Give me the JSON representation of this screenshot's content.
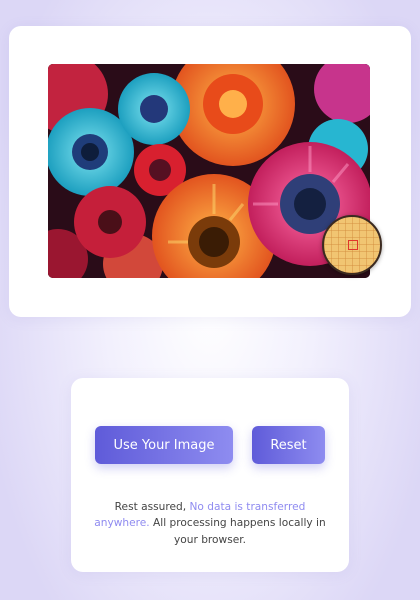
{
  "image_card": {
    "image_alt": "Colorful gerbera daisy flowers",
    "magnifier_icon": "magnifier-loupe-icon"
  },
  "controls": {
    "use_image_label": "Use Your Image",
    "reset_label": "Reset"
  },
  "privacy_note": {
    "prefix": "Rest assured, ",
    "highlight": "No data is transferred anywhere.",
    "suffix": " All processing happens locally in your browser."
  },
  "colors": {
    "accent_start": "#5f5bd9",
    "accent_end": "#8e8cf0",
    "highlight_text": "#8f8bf0"
  }
}
